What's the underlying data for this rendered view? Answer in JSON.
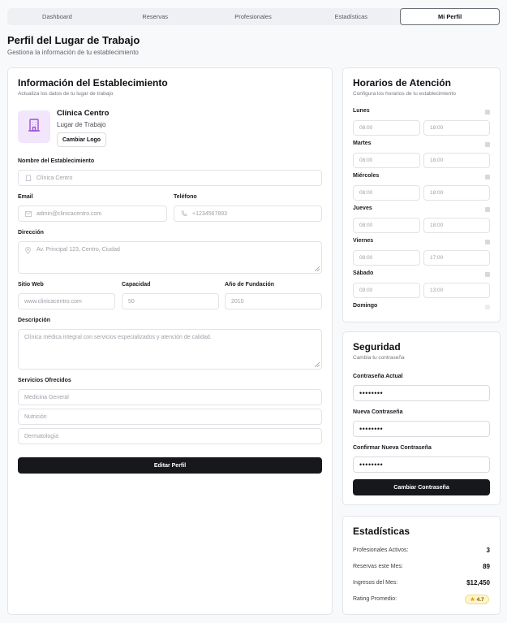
{
  "tabs": [
    "Dashboard",
    "Reservas",
    "Profesionales",
    "Estadísticas",
    "Mi Perfil"
  ],
  "page": {
    "title": "Perfil del Lugar de Trabajo",
    "subtitle": "Gestiona la información de tu establecimiento"
  },
  "info": {
    "title": "Información del Establecimiento",
    "subtitle": "Actualiza los datos de tu lugar de trabajo",
    "name": "Clínica Centro",
    "type": "Lugar de Trabajo",
    "change_logo": "Cambiar Logo",
    "fields": {
      "name_label": "Nombre del Establecimiento",
      "name_value": "Clínica Centro",
      "email_label": "Email",
      "email_value": "admin@clinicacentro.com",
      "phone_label": "Teléfono",
      "phone_value": "+1234567893",
      "address_label": "Dirección",
      "address_value": "Av. Principal 123, Centro, Ciudad",
      "website_label": "Sitio Web",
      "website_value": "www.clinicacentro.com",
      "capacity_label": "Capacidad",
      "capacity_value": "50",
      "year_label": "Año de Fundación",
      "year_value": "2010",
      "desc_label": "Descripción",
      "desc_value": "Clínica médica integral con servicios especializados y atención de calidad.",
      "services_label": "Servicios Ofrecidos",
      "services": [
        "Medicina General",
        "Nutrición",
        "Dermatología"
      ]
    },
    "edit_button": "Editar Perfil"
  },
  "hours": {
    "title": "Horarios de Atención",
    "subtitle": "Configura los horarios de tu establecimiento",
    "days": [
      {
        "day": "Lunes",
        "open": "08:00",
        "close": "18:00",
        "enabled": true
      },
      {
        "day": "Martes",
        "open": "08:00",
        "close": "18:00",
        "enabled": true
      },
      {
        "day": "Miércoles",
        "open": "08:00",
        "close": "18:00",
        "enabled": true
      },
      {
        "day": "Jueves",
        "open": "08:00",
        "close": "18:00",
        "enabled": true
      },
      {
        "day": "Viernes",
        "open": "08:00",
        "close": "17:00",
        "enabled": true
      },
      {
        "day": "Sábado",
        "open": "09:00",
        "close": "13:00",
        "enabled": true
      },
      {
        "day": "Domingo",
        "open": "",
        "close": "",
        "enabled": false
      }
    ]
  },
  "security": {
    "title": "Seguridad",
    "subtitle": "Cambia tu contraseña",
    "current_label": "Contraseña Actual",
    "new_label": "Nueva Contraseña",
    "confirm_label": "Confirmar Nueva Contraseña",
    "masked": "••••••••",
    "button": "Cambiar Contraseña"
  },
  "stats": {
    "title": "Estadísticas",
    "items": [
      {
        "label": "Profesionales Activos:",
        "value": "3"
      },
      {
        "label": "Reservas este Mes:",
        "value": "89"
      },
      {
        "label": "Ingresos del Mes:",
        "value": "$12,450"
      },
      {
        "label": "Rating Promedio:",
        "value": "4.7"
      }
    ]
  },
  "colors": {
    "accent_dark": "#17181c",
    "logo_bg": "#f1e6fb",
    "logo_icon": "#9b4fd6",
    "rating_bg": "#fff4cc"
  }
}
